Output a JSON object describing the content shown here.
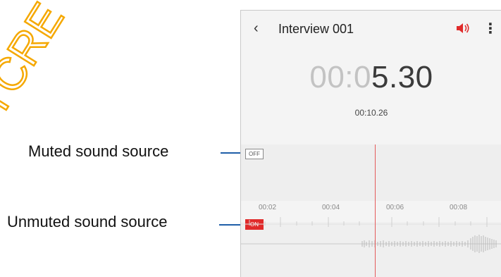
{
  "callouts": {
    "muted": "Muted sound source",
    "unmuted": "Unmuted sound source"
  },
  "app": {
    "title": "Interview 001",
    "back_icon": "chevron-left-icon",
    "speaker_icon": "speaker-icon",
    "more_icon": "more-vertical-icon",
    "accent": "#e02b2b"
  },
  "timer": {
    "dim": "00:0",
    "bold": "5.30",
    "total": "00:10.26"
  },
  "tracks": {
    "off_label": "OFF",
    "on_label": "ON"
  },
  "timeline": {
    "ticks": [
      "00:02",
      "00:04",
      "00:06",
      "00:08"
    ]
  }
}
